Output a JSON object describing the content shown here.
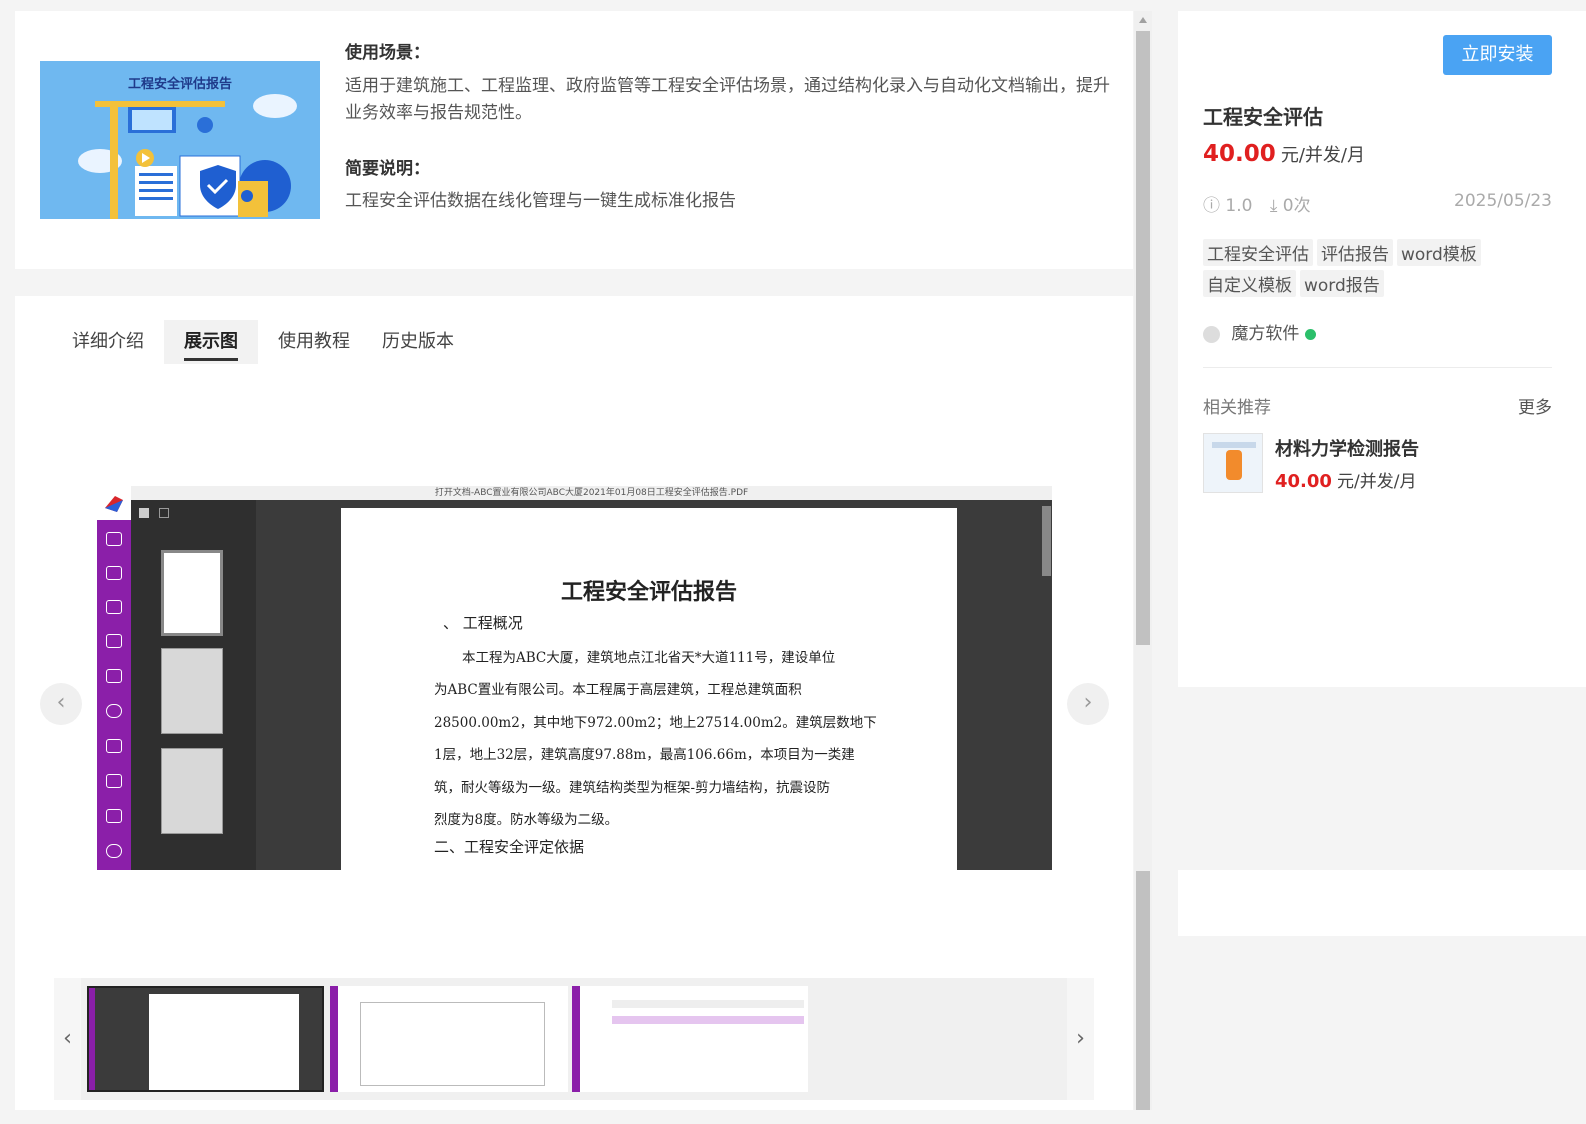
{
  "detail": {
    "banner_title": "工程安全评估报告",
    "usage_heading": "使用场景：",
    "usage_text": "适用于建筑施工、工程监理、政府监管等工程安全评估场景，通过结构化录入与自动化文档输出，提升业务效率与报告规范性。",
    "summary_heading": "简要说明：",
    "summary_text": "工程安全评估数据在线化管理与一键生成标准化报告"
  },
  "tabs": [
    {
      "label": "详细介绍",
      "active": false
    },
    {
      "label": "展示图",
      "active": true
    },
    {
      "label": "使用教程",
      "active": false
    },
    {
      "label": "历史版本",
      "active": false
    }
  ],
  "showcase": {
    "window_title": "打开文档-ABC置业有限公司ABC大厦2021年01月08日工程安全评估报告.PDF",
    "doc_title": "工程安全评估报告",
    "section1": "、 工程概况",
    "lines": [
      "本工程为ABC大厦，建筑地点江北省天*大道111号，建设单位",
      "为ABC置业有限公司。本工程属于高层建筑，工程总建筑面积",
      "28500.00m2，其中地下972.00m2；地上27514.00m2。建筑层数地下",
      "1层，地上32层，建筑高度97.88m，最高106.66m，本项目为一类建",
      "筑，耐火等级为一级。建筑结构类型为框架-剪力墙结构，抗震设防",
      "烈度为8度。防水等级为二级。"
    ],
    "section2": "二、工程安全评定依据",
    "prev": "‹",
    "next": "›"
  },
  "product": {
    "install_label": "立即安装",
    "name": "工程安全评估",
    "price": "40.00",
    "price_unit": "元/并发/月",
    "version": "1.0",
    "downloads": "0次",
    "date": "2025/05/23",
    "tags": [
      "工程安全评估",
      "评估报告",
      "word模板",
      "自定义模板",
      "word报告"
    ],
    "author": "魔方软件",
    "related_heading": "相关推荐",
    "more_label": "更多",
    "related": [
      {
        "name": "材料力学检测报告",
        "price": "40.00",
        "price_unit": "元/并发/月"
      }
    ]
  },
  "colors": {
    "accent": "#4aa3f3",
    "price": "#e02020",
    "sidebar_purple": "#8b1fa9",
    "verified": "#2bbf6a"
  }
}
